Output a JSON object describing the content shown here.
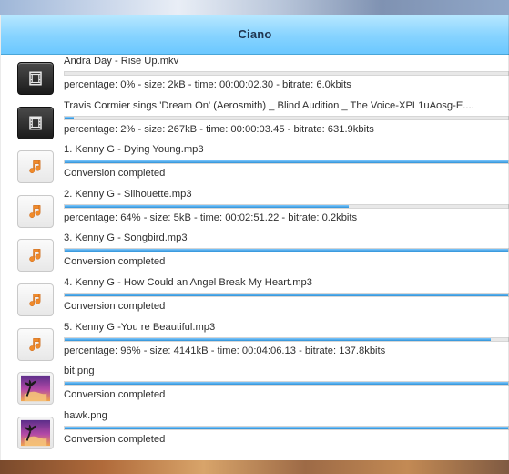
{
  "window": {
    "title": "Ciano"
  },
  "items": [
    {
      "icon": "film-icon",
      "type": "video",
      "filename": "Andra Day - Rise Up.mkv",
      "progress_fraction": 0.0,
      "status": "percentage: 0% - size: 2kB - time: 00:00:02.30 - bitrate: 6.0kbits"
    },
    {
      "icon": "film-icon",
      "type": "video",
      "filename": "Travis Cormier sings 'Dream On' (Aerosmith) _ Blind Audition _ The Voice-XPL1uAosg-E....",
      "progress_fraction": 0.02,
      "status": "percentage: 2% - size: 267kB - time: 00:00:03.45 - bitrate: 631.9kbits"
    },
    {
      "icon": "music-note-icon",
      "type": "audio",
      "filename": "1. Kenny G - Dying Young.mp3",
      "progress_fraction": 1.0,
      "status": "Conversion completed"
    },
    {
      "icon": "music-note-icon",
      "type": "audio",
      "filename": "2. Kenny G - Silhouette.mp3",
      "progress_fraction": 0.64,
      "status": "percentage: 64% - size: 5kB - time: 00:02:51.22 - bitrate: 0.2kbits"
    },
    {
      "icon": "music-note-icon",
      "type": "audio",
      "filename": "3. Kenny G - Songbird.mp3",
      "progress_fraction": 1.0,
      "status": "Conversion completed"
    },
    {
      "icon": "music-note-icon",
      "type": "audio",
      "filename": "4. Kenny G - How Could an Angel Break My Heart.mp3",
      "progress_fraction": 1.0,
      "status": "Conversion completed"
    },
    {
      "icon": "music-note-icon",
      "type": "audio",
      "filename": "5. Kenny G -You re Beautiful.mp3",
      "progress_fraction": 0.96,
      "status": "percentage: 96% - size: 4141kB - time: 00:04:06.13 - bitrate: 137.8kbits"
    },
    {
      "icon": "image-thumbnail-icon",
      "type": "image",
      "filename": "bit.png",
      "progress_fraction": 1.0,
      "status": "Conversion completed"
    },
    {
      "icon": "image-thumbnail-icon",
      "type": "image",
      "filename": "hawk.png",
      "progress_fraction": 1.0,
      "status": "Conversion completed"
    }
  ],
  "colors": {
    "titlebar_top": "#b8e8ff",
    "titlebar_bottom": "#6cc8ff",
    "progress_fill": "#2f92d8",
    "progress_track": "#e8e8e8",
    "text": "#2f2f2f"
  }
}
